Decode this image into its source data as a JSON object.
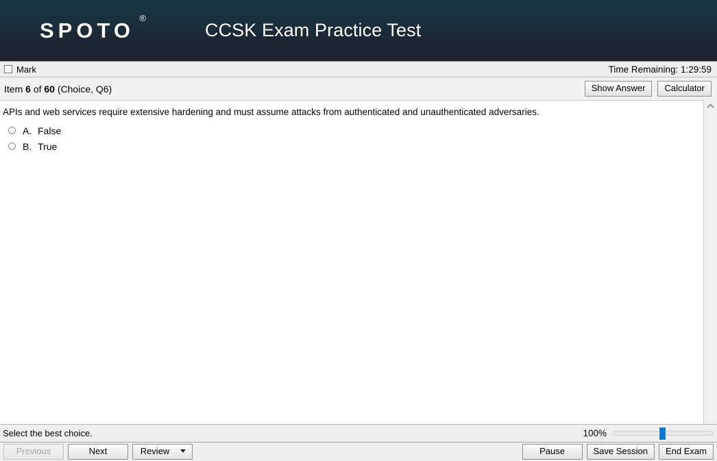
{
  "header": {
    "brand": "SPOTO",
    "brand_mark": "®",
    "title": "CCSK Exam Practice Test"
  },
  "markbar": {
    "mark_label": "Mark",
    "timer": "Time Remaining: 1:29:59"
  },
  "item_header": {
    "prefix": "Item",
    "current": "6",
    "of": "of",
    "total": "60",
    "meta": "(Choice, Q6)",
    "show_answer_label": "Show Answer",
    "calculator_label": "Calculator"
  },
  "question": {
    "stem": "APIs and web services require extensive hardening and must assume attacks from authenticated and unauthenticated adversaries.",
    "choices": [
      {
        "letter": "A.",
        "text": "False",
        "selected": false
      },
      {
        "letter": "B.",
        "text": "True",
        "selected": false
      }
    ]
  },
  "statusbar": {
    "instruction": "Select the best choice.",
    "zoom_percent": "100%"
  },
  "toolbar": {
    "previous_label": "Previous",
    "next_label": "Next",
    "review_label": "Review",
    "pause_label": "Pause",
    "save_session_label": "Save Session",
    "end_exam_label": "End Exam"
  },
  "colors": {
    "header_top": "#16353f",
    "header_bottom": "#20212e",
    "slider_thumb": "#0b7ad6",
    "chrome": "#eeeeee"
  }
}
